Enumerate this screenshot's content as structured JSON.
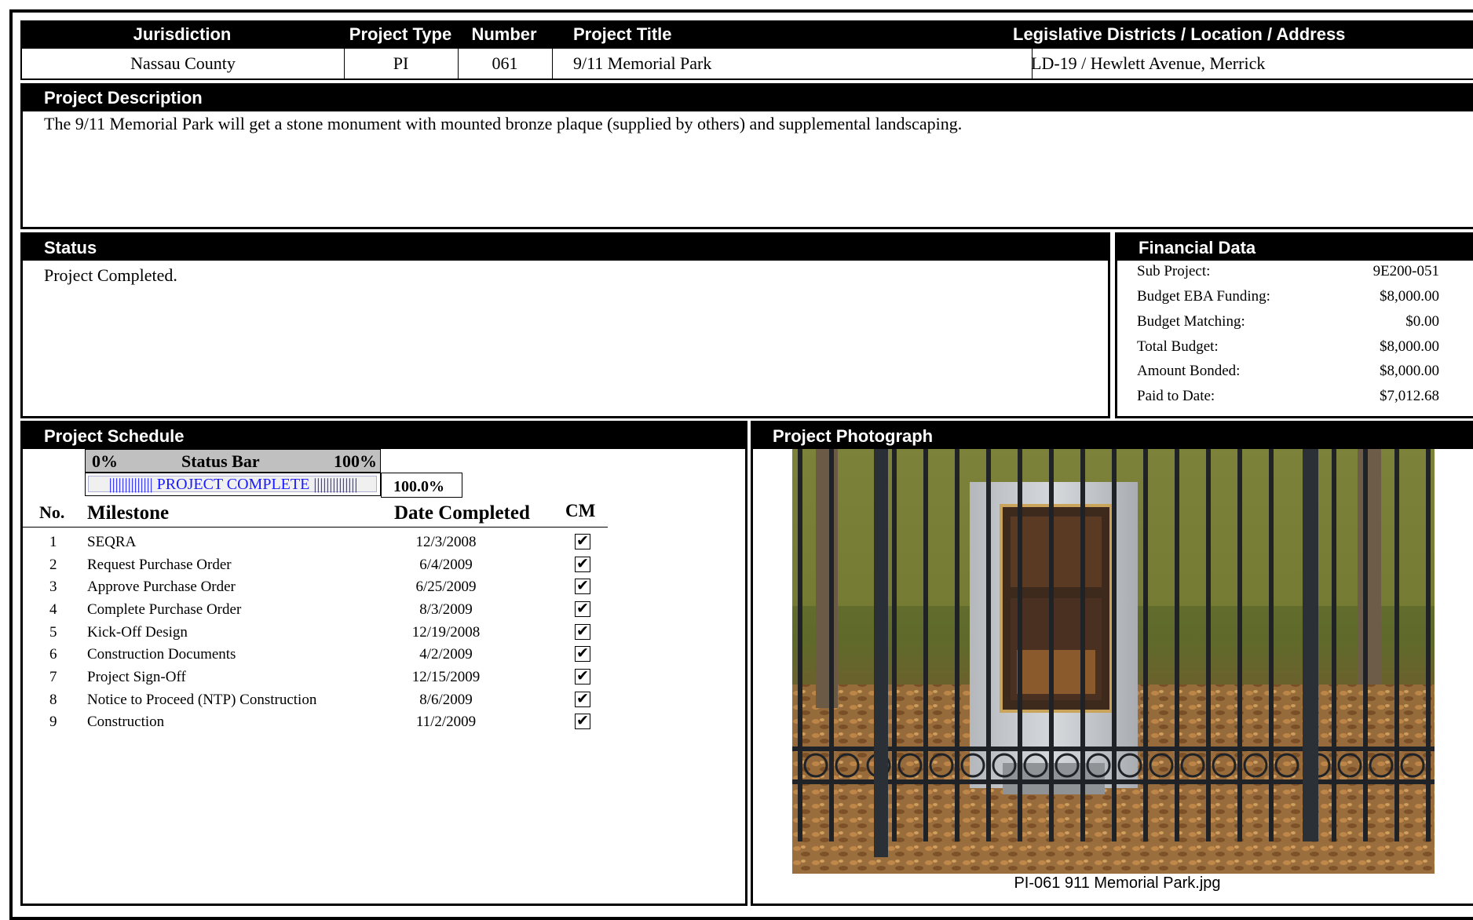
{
  "header": {
    "columns": [
      "Jurisdiction",
      "Project Type",
      "Number",
      "Project Title",
      "Legislative Districts / Location / Address"
    ],
    "values": [
      "Nassau County",
      "PI",
      "061",
      "9/11 Memorial Park",
      "LD-19 / Hewlett Avenue, Merrick"
    ]
  },
  "description": {
    "title": "Project Description",
    "text": "The 9/11 Memorial Park will get a stone monument with mounted bronze plaque (supplied by others) and supplemental landscaping."
  },
  "status": {
    "title": "Status",
    "text": "Project Completed."
  },
  "financial": {
    "title": "Financial Data",
    "rows": [
      {
        "label": "Sub Project:",
        "value": "9E200-051"
      },
      {
        "label": "Budget EBA Funding:",
        "value": "$8,000.00"
      },
      {
        "label": "Budget Matching:",
        "value": "$0.00"
      },
      {
        "label": "Total Budget:",
        "value": "$8,000.00"
      },
      {
        "label": "Amount Bonded:",
        "value": "$8,000.00"
      },
      {
        "label": "Paid to Date:",
        "value": "$7,012.68"
      }
    ]
  },
  "schedule": {
    "title": "Project Schedule",
    "status_bar": {
      "min_label": "0%",
      "title": "Status Bar",
      "max_label": "100%",
      "text": "|||||||||||||| PROJECT COMPLETE ||||||||||||||",
      "percent_text": "100.0%",
      "progress": 1.0
    },
    "columns": {
      "no": "No.",
      "milestone": "Milestone",
      "date": "Date Completed",
      "cm": "CM"
    },
    "milestones": [
      {
        "no": "1",
        "name": "SEQRA",
        "date": "12/3/2008",
        "cm": "✔"
      },
      {
        "no": "2",
        "name": "Request Purchase Order",
        "date": "6/4/2009",
        "cm": "✔"
      },
      {
        "no": "3",
        "name": "Approve Purchase Order",
        "date": "6/25/2009",
        "cm": "✔"
      },
      {
        "no": "4",
        "name": "Complete Purchase Order",
        "date": "8/3/2009",
        "cm": "✔"
      },
      {
        "no": "5",
        "name": "Kick-Off Design",
        "date": "12/19/2008",
        "cm": "✔"
      },
      {
        "no": "6",
        "name": "Construction Documents",
        "date": "4/2/2009",
        "cm": "✔"
      },
      {
        "no": "7",
        "name": "Project Sign-Off",
        "date": "12/15/2009",
        "cm": "✔"
      },
      {
        "no": "8",
        "name": "Notice to Proceed (NTP) Construction",
        "date": "8/6/2009",
        "cm": "✔"
      },
      {
        "no": "9",
        "name": "Construction",
        "date": "11/2/2009",
        "cm": "✔"
      }
    ]
  },
  "photo": {
    "title": "Project Photograph",
    "caption": "PI-061 911 Memorial Park.jpg"
  }
}
